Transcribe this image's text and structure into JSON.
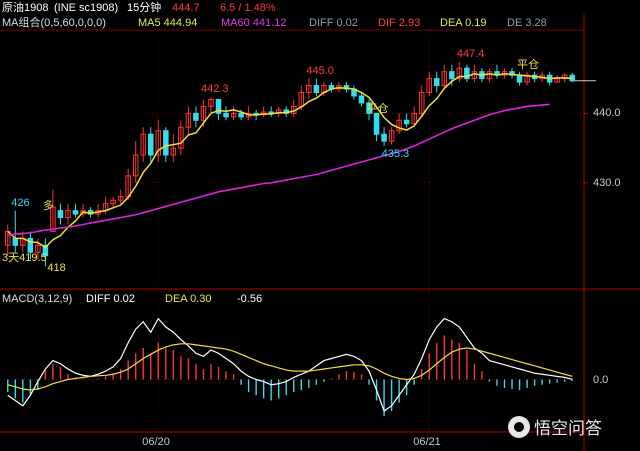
{
  "header": {
    "line1": [
      {
        "text": "原油1908",
        "color": "#ffffff"
      },
      {
        "text": "(INE sc1908)",
        "color": "#ffffff"
      },
      {
        "text": "15分钟",
        "color": "#ffffff"
      },
      {
        "text": "444.7",
        "color": "#ff3b3b"
      },
      {
        "text": "6.5 / 1.48%",
        "color": "#ff3b3b"
      }
    ],
    "line2": [
      {
        "text": "MA组合(0,5,60,0,0,0)",
        "color": "#dddddd"
      },
      {
        "text": "MA5 444.94",
        "color": "#e8e84a"
      },
      {
        "text": "MA60 441.12",
        "color": "#e23be2"
      },
      {
        "text": "DIFF 0.02",
        "color": "#9a9a9a"
      },
      {
        "text": "DIF 2.93",
        "color": "#ff4040"
      },
      {
        "text": "DEA 0.19",
        "color": "#e8e84a"
      },
      {
        "text": "DE 3.28",
        "color": "#9a9a9a"
      }
    ]
  },
  "macd_header": [
    {
      "text": "MACD(3,12,9)",
      "color": "#dddddd"
    },
    {
      "text": "DIFF 0.02",
      "color": "#ffffff"
    },
    {
      "text": "DEA 0.30",
      "color": "#e8e84a"
    },
    {
      "text": "-0.56",
      "color": "#ffffff"
    }
  ],
  "colors": {
    "up": "#ff3333",
    "down": "#33ddee",
    "ma5": "#f0e040",
    "ma60": "#dd22dd",
    "diff": "#ffffff",
    "dea": "#f0e040",
    "axis": "#b80000",
    "grid": "#700000"
  },
  "watermark": "悟空问答",
  "chart_data": [
    {
      "type": "candlestick",
      "ylim": [
        415,
        452
      ],
      "y_ticks": [
        {
          "value": 430,
          "label": "430.0"
        },
        {
          "value": 440,
          "label": "440.0"
        }
      ],
      "x_ticks": [
        {
          "index": 20,
          "label": "06/20"
        },
        {
          "index": 56,
          "label": "06/21"
        }
      ],
      "annotations": [
        {
          "text": "426",
          "index": 1,
          "value": 426,
          "color": "#33ddee"
        },
        {
          "text": "442.3",
          "index": 27,
          "value": 442.3,
          "color": "#ff4040"
        },
        {
          "text": "445.0",
          "index": 41,
          "value": 445.0,
          "color": "#ff4040"
        },
        {
          "text": "447.4",
          "index": 61,
          "value": 447.4,
          "color": "#ff4040"
        },
        {
          "text": "435.3",
          "index": 51,
          "value": 435.3,
          "color": "#33ddee"
        },
        {
          "text": "418",
          "index": 5,
          "value": 418,
          "color": "#f0e040"
        },
        {
          "text": "3天419.5",
          "index": 0,
          "value": 419.5,
          "color": "#f0e040"
        },
        {
          "text": "平仓",
          "index": 49,
          "value": 439.5,
          "color": "#f0e040"
        },
        {
          "text": "平仓",
          "index": 69,
          "value": 445.8,
          "color": "#f0e040"
        },
        {
          "text": "多",
          "index": 6,
          "value": 425.5,
          "color": "#f0e040"
        }
      ],
      "candles": [
        {
          "o": 421,
          "c": 423,
          "h": 424,
          "l": 419.5
        },
        {
          "o": 422,
          "c": 421,
          "h": 426,
          "l": 420
        },
        {
          "o": 421,
          "c": 422,
          "h": 423,
          "l": 420
        },
        {
          "o": 422,
          "c": 420,
          "h": 423,
          "l": 419
        },
        {
          "o": 420,
          "c": 421,
          "h": 422,
          "l": 419
        },
        {
          "o": 421,
          "c": 419.5,
          "h": 422,
          "l": 418
        },
        {
          "o": 423,
          "c": 426.5,
          "h": 429,
          "l": 423
        },
        {
          "o": 426,
          "c": 425,
          "h": 427,
          "l": 424
        },
        {
          "o": 425,
          "c": 426,
          "h": 427,
          "l": 424
        },
        {
          "o": 426,
          "c": 425.5,
          "h": 427,
          "l": 425
        },
        {
          "o": 425.5,
          "c": 426,
          "h": 427,
          "l": 425
        },
        {
          "o": 426,
          "c": 425.5,
          "h": 426.5,
          "l": 425
        },
        {
          "o": 425.5,
          "c": 426,
          "h": 427,
          "l": 425
        },
        {
          "o": 426,
          "c": 427,
          "h": 428,
          "l": 425.5
        },
        {
          "o": 427,
          "c": 427.5,
          "h": 428,
          "l": 426.5
        },
        {
          "o": 427.5,
          "c": 428,
          "h": 429,
          "l": 427
        },
        {
          "o": 428,
          "c": 431,
          "h": 432,
          "l": 427.5
        },
        {
          "o": 431,
          "c": 434,
          "h": 436,
          "l": 430
        },
        {
          "o": 434,
          "c": 437,
          "h": 438,
          "l": 433
        },
        {
          "o": 437,
          "c": 434,
          "h": 438,
          "l": 433
        },
        {
          "o": 434,
          "c": 437.5,
          "h": 439,
          "l": 433
        },
        {
          "o": 437.5,
          "c": 434,
          "h": 438,
          "l": 433
        },
        {
          "o": 434,
          "c": 435,
          "h": 437,
          "l": 433
        },
        {
          "o": 435,
          "c": 438,
          "h": 439,
          "l": 434
        },
        {
          "o": 438,
          "c": 440,
          "h": 441,
          "l": 437
        },
        {
          "o": 440,
          "c": 439,
          "h": 441,
          "l": 438
        },
        {
          "o": 439,
          "c": 441,
          "h": 442,
          "l": 438
        },
        {
          "o": 441,
          "c": 442,
          "h": 442.3,
          "l": 440
        },
        {
          "o": 442,
          "c": 440,
          "h": 442,
          "l": 439
        },
        {
          "o": 440,
          "c": 439.5,
          "h": 441,
          "l": 439
        },
        {
          "o": 439.5,
          "c": 440,
          "h": 441,
          "l": 439
        },
        {
          "o": 440,
          "c": 439.5,
          "h": 440.5,
          "l": 439
        },
        {
          "o": 439.5,
          "c": 440,
          "h": 441,
          "l": 439
        },
        {
          "o": 440,
          "c": 439.8,
          "h": 440.5,
          "l": 439
        },
        {
          "o": 439.8,
          "c": 440.2,
          "h": 441,
          "l": 439.5
        },
        {
          "o": 440.2,
          "c": 440,
          "h": 441,
          "l": 439.5
        },
        {
          "o": 440,
          "c": 440.5,
          "h": 441,
          "l": 439.5
        },
        {
          "o": 440.5,
          "c": 440,
          "h": 441,
          "l": 439.5
        },
        {
          "o": 440,
          "c": 441,
          "h": 442,
          "l": 439.5
        },
        {
          "o": 441,
          "c": 443,
          "h": 444,
          "l": 440.5
        },
        {
          "o": 443,
          "c": 444,
          "h": 445,
          "l": 442
        },
        {
          "o": 444,
          "c": 443,
          "h": 445,
          "l": 442.5
        },
        {
          "o": 443,
          "c": 444,
          "h": 444.5,
          "l": 442.5
        },
        {
          "o": 444,
          "c": 443.5,
          "h": 444.5,
          "l": 443
        },
        {
          "o": 443.5,
          "c": 444,
          "h": 444.5,
          "l": 443
        },
        {
          "o": 444,
          "c": 443.5,
          "h": 444.5,
          "l": 443
        },
        {
          "o": 443.5,
          "c": 442.5,
          "h": 444,
          "l": 442
        },
        {
          "o": 442.5,
          "c": 441.5,
          "h": 443,
          "l": 441
        },
        {
          "o": 441.5,
          "c": 440,
          "h": 442,
          "l": 439
        },
        {
          "o": 440,
          "c": 437,
          "h": 440,
          "l": 436
        },
        {
          "o": 437,
          "c": 436,
          "h": 438,
          "l": 435.3
        },
        {
          "o": 436,
          "c": 437.5,
          "h": 438,
          "l": 435.5
        },
        {
          "o": 437.5,
          "c": 439,
          "h": 440,
          "l": 437
        },
        {
          "o": 439,
          "c": 438.5,
          "h": 440,
          "l": 438
        },
        {
          "o": 438.5,
          "c": 440,
          "h": 441,
          "l": 438
        },
        {
          "o": 440,
          "c": 443,
          "h": 444,
          "l": 439.5
        },
        {
          "o": 443,
          "c": 445,
          "h": 446,
          "l": 442.5
        },
        {
          "o": 445,
          "c": 444,
          "h": 446,
          "l": 443
        },
        {
          "o": 444,
          "c": 446,
          "h": 447,
          "l": 443.5
        },
        {
          "o": 446,
          "c": 445,
          "h": 447,
          "l": 444
        },
        {
          "o": 445,
          "c": 446.5,
          "h": 447.4,
          "l": 444.5
        },
        {
          "o": 446.5,
          "c": 445,
          "h": 447,
          "l": 444.5
        },
        {
          "o": 445,
          "c": 446,
          "h": 447,
          "l": 444.5
        },
        {
          "o": 446,
          "c": 445,
          "h": 446.5,
          "l": 444.5
        },
        {
          "o": 445,
          "c": 446,
          "h": 446.5,
          "l": 444.5
        },
        {
          "o": 446,
          "c": 445.5,
          "h": 447,
          "l": 445
        },
        {
          "o": 445.5,
          "c": 446,
          "h": 446.5,
          "l": 445
        },
        {
          "o": 446,
          "c": 445.5,
          "h": 446.5,
          "l": 445
        },
        {
          "o": 445.5,
          "c": 444.5,
          "h": 446,
          "l": 444
        },
        {
          "o": 444.5,
          "c": 445.5,
          "h": 446,
          "l": 444
        },
        {
          "o": 445.5,
          "c": 445,
          "h": 446,
          "l": 444.5
        },
        {
          "o": 445,
          "c": 445.5,
          "h": 446,
          "l": 444.5
        },
        {
          "o": 445.5,
          "c": 444.5,
          "h": 446,
          "l": 444
        },
        {
          "o": 444.5,
          "c": 445,
          "h": 445.5,
          "l": 444.5
        },
        {
          "o": 445,
          "c": 445.5,
          "h": 445.8,
          "l": 444.5
        },
        {
          "o": 445.5,
          "c": 444.7,
          "h": 445.8,
          "l": 444.5
        }
      ],
      "ma60": [
        422.5,
        422.6,
        422.7,
        422.8,
        423,
        423.2,
        423.3,
        423.5,
        423.6,
        423.8,
        424,
        424.2,
        424.4,
        424.6,
        424.8,
        425,
        425.2,
        425.4,
        425.7,
        426,
        426.3,
        426.6,
        426.9,
        427.2,
        427.5,
        427.8,
        428.1,
        428.4,
        428.7,
        428.9,
        429.1,
        429.3,
        429.5,
        429.7,
        429.9,
        430,
        430.2,
        430.4,
        430.6,
        430.8,
        431,
        431.2,
        431.5,
        431.8,
        432.1,
        432.4,
        432.7,
        433,
        433.3,
        433.6,
        433.9,
        434.2,
        434.5,
        434.9,
        435.3,
        435.8,
        436.3,
        436.8,
        437.3,
        437.8,
        438.2,
        438.6,
        439,
        439.4,
        439.8,
        440.1,
        440.4,
        440.6,
        440.8,
        441,
        441.1,
        441.2,
        441.3
      ]
    },
    {
      "type": "macd",
      "ylim": [
        -5,
        7
      ],
      "y_ticks": [
        {
          "value": 0,
          "label": "0.0"
        }
      ],
      "hist": [
        -1.2,
        -1.8,
        -2.2,
        -1.5,
        -1.0,
        0.8,
        1.5,
        1.2,
        0.5,
        0.2,
        0.1,
        0,
        0.1,
        0.3,
        0.5,
        1,
        1.8,
        2.5,
        3,
        2.5,
        3.5,
        3,
        2.8,
        2.2,
        2,
        1.5,
        1,
        1.5,
        1.2,
        0.8,
        0.5,
        -0.5,
        -1.2,
        -1.5,
        -1.8,
        -2,
        -1.8,
        -1.5,
        -1.2,
        -1,
        -0.8,
        -0.5,
        -0.2,
        0.1,
        0.5,
        0.8,
        0.7,
        0.5,
        -0.5,
        -2,
        -3.5,
        -3,
        -2.2,
        -1.5,
        -0.5,
        1,
        2.5,
        3.5,
        4.2,
        3.8,
        3.5,
        2.8,
        1.5,
        0.8,
        -0.2,
        -0.6,
        -0.8,
        -0.9,
        -1,
        -0.8,
        -0.6,
        -0.5,
        -0.4,
        -0.3,
        -0.2,
        -0.15
      ],
      "diff": [
        -1.5,
        -2,
        -2.5,
        -1.5,
        -0.2,
        1,
        1.8,
        1.5,
        1,
        0.6,
        0.4,
        0.3,
        0.5,
        0.8,
        1.2,
        2,
        3.5,
        4.8,
        5.5,
        4.5,
        5.8,
        5,
        4.5,
        3.8,
        3.2,
        2.5,
        2.2,
        2.8,
        2.5,
        2,
        1.5,
        0.8,
        0.3,
        0,
        -0.2,
        -0.5,
        -0.4,
        -0.2,
        0.2,
        0.5,
        0.8,
        1.3,
        1.8,
        2,
        2.2,
        2.4,
        2.2,
        1.8,
        0.8,
        -1,
        -3,
        -2.5,
        -1.5,
        -0.5,
        0.5,
        2,
        3.8,
        5,
        5.8,
        5.5,
        5,
        4,
        3,
        2.5,
        1.8,
        1.6,
        1.4,
        1.2,
        1,
        0.8,
        0.6,
        0.5,
        0.4,
        0.3,
        0.2,
        0.02
      ],
      "dea": [
        -0.5,
        -0.7,
        -0.9,
        -1,
        -0.9,
        -0.7,
        -0.4,
        -0.2,
        0,
        0.1,
        0.2,
        0.3,
        0.35,
        0.4,
        0.5,
        0.7,
        1,
        1.5,
        2,
        2.4,
        2.8,
        3.1,
        3.3,
        3.4,
        3.4,
        3.3,
        3.2,
        3.1,
        3,
        2.9,
        2.7,
        2.4,
        2.1,
        1.8,
        1.5,
        1.3,
        1.1,
        0.9,
        0.8,
        0.8,
        0.8,
        0.9,
        1,
        1.1,
        1.2,
        1.3,
        1.4,
        1.4,
        1.3,
        1,
        0.6,
        0.3,
        0.1,
        0,
        0.1,
        0.4,
        0.9,
        1.5,
        2.1,
        2.6,
        2.9,
        3,
        2.9,
        2.7,
        2.5,
        2.3,
        2.1,
        1.9,
        1.7,
        1.5,
        1.3,
        1.1,
        0.9,
        0.7,
        0.5,
        0.3
      ]
    }
  ]
}
